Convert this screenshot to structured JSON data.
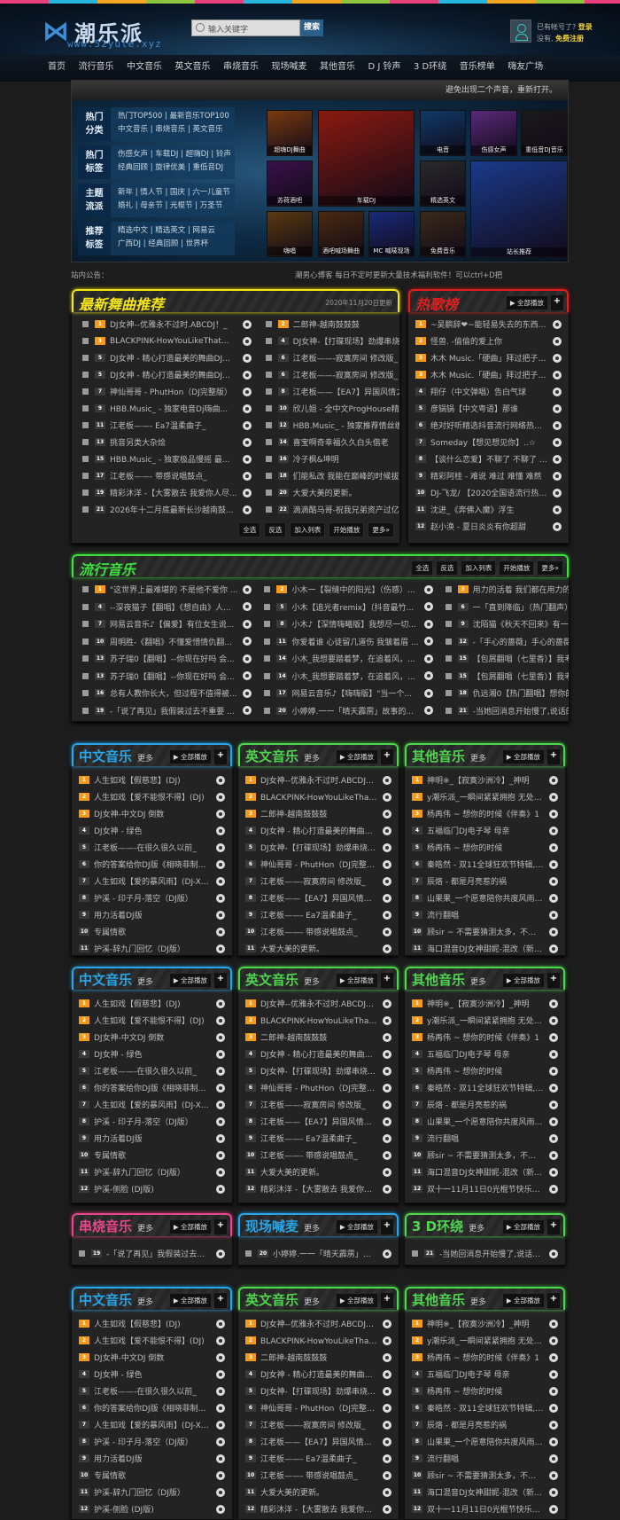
{
  "header": {
    "logo_mark": "⋈",
    "logo_text": "潮乐派",
    "logo_url": "www.52yule.xyz",
    "search_placeholder": "输入关键字",
    "search_button": "搜索",
    "account_prompt": "已有帐号了?",
    "login": "登录",
    "no_account": "没有,",
    "register": "免费注册"
  },
  "nav": [
    "首页",
    "流行音乐",
    "中文音乐",
    "英文音乐",
    "串烧音乐",
    "现场喊麦",
    "其他音乐",
    "D J 铃声",
    "3 D环绕",
    "音乐榜单",
    "嗨友广场"
  ],
  "banner": {
    "bar_text": "避免出现二个声音，重新打开。",
    "categories": [
      {
        "title": "热门分类",
        "line1": "热门TOP500 | 最新音乐TOP100",
        "line2": "中文音乐 | 串烧音乐 | 英文音乐"
      },
      {
        "title": "热门标签",
        "line1": "伤感女声 | 车载DJ | 超嗨DJ | 铃声",
        "line2": "经典回顾 | 旋律优美 | 重低音DJ"
      },
      {
        "title": "主题流派",
        "line1": "新年 | 情人节 | 国庆 | 六一儿童节",
        "line2": "婚礼 | 母亲节 | 光棍节 | 万圣节"
      },
      {
        "title": "推荐标签",
        "line1": "精选中文 | 精选英文 | 网易云",
        "line2": "广西DJ | 经典回顾 | 世界杯"
      }
    ],
    "tiles": [
      "超嗨DJ舞曲",
      "车载DJ",
      "电音",
      "伤感女声",
      "重低音DJ音乐",
      "苏荷酒吧",
      "精选英文",
      "站长推荐",
      "嗨唱",
      "酒吧喊场舞曲",
      "MC 喊唛现场",
      "免费音乐"
    ]
  },
  "notice": {
    "label": "站内公告：",
    "text": "潮男心博客 每日不定时更新大量技术福利软件！可以ctrl+D把"
  },
  "latest": {
    "title": "最新舞曲推荐",
    "date": "2020年11月20日更新",
    "color": "#f5e51b",
    "songs": [
      {
        "n": "1",
        "t": "DJ女神--优雅永不过时.ABCDJ！_"
      },
      {
        "n": "2",
        "t": "二郎神-越南鼓鼓鼓"
      },
      {
        "n": "3",
        "t": "BLACKPINK-HowYouLikeThat..."
      },
      {
        "n": "4",
        "t": "DJ女神-【打碟现场】劲爆串烧蹦..."
      },
      {
        "n": "5",
        "t": "DJ女神 - 精心打造最美的舞曲DJ..."
      },
      {
        "n": "6",
        "t": "江老板——-寂寞房间 修改版_"
      },
      {
        "n": "5",
        "t": "DJ女神 - 精心打造最美的舞曲DJ..."
      },
      {
        "n": "6",
        "t": "江老板——-寂寞房间 修改版_"
      },
      {
        "n": "7",
        "t": "神仙哥哥 - PhutHon（DJ完整版）"
      },
      {
        "n": "8",
        "t": "江老板——【EA7】异国风情之情..."
      },
      {
        "n": "9",
        "t": "HBB.Music_ - 独家电音Dj嗨曲..."
      },
      {
        "n": "10",
        "t": "欣儿姐 - 全中文ProgHouse精选..."
      },
      {
        "n": "11",
        "t": "江老板——- Ea7温柔曲子_"
      },
      {
        "n": "12",
        "t": "HBB.Music_ - 独家推荐情丝缠绕..."
      },
      {
        "n": "13",
        "t": "挑音另类大杂烩"
      },
      {
        "n": "14",
        "t": "喜宝啊奇幸福久久白头偕老"
      },
      {
        "n": "15",
        "t": "HBB.Music_ - 独家极品慢摇 最..."
      },
      {
        "n": "16",
        "t": "冷子枫&坤明"
      },
      {
        "n": "17",
        "t": "江老板——- 带感说唱鼓点_"
      },
      {
        "n": "18",
        "t": "们能私改 我能在巅峰的时候拔鸦..."
      },
      {
        "n": "19",
        "t": "精彩沐洋 -【大雾散去 我爱你人尽..."
      },
      {
        "n": "20",
        "t": "大爱大美的更新。"
      },
      {
        "n": "21",
        "t": "2026年十二月底最新长沙越南鼓..."
      },
      {
        "n": "22",
        "t": "滴滴酷马哥-祝我兄弟资产过亿绝..."
      }
    ],
    "buttons": [
      "全选",
      "反选",
      "加入列表",
      "开始播放",
      "更多»"
    ]
  },
  "hot": {
    "title": "热歌榜",
    "color": "#e02020",
    "play_all": "全部播放",
    "songs": [
      {
        "n": "1",
        "t": "~吴鹏辞❤~能轻易失去的东西确实该..."
      },
      {
        "n": "2",
        "t": "怪兽. -偷偷的爱上你"
      },
      {
        "n": "3",
        "t": "木木 Music.「硬曲」拜过把子发过誓..."
      },
      {
        "n": "3",
        "t": "木木 Music.「硬曲」拜过把子发过誓..."
      },
      {
        "n": "4",
        "t": "翔仔（中文弹唱）告白气球"
      },
      {
        "n": "5",
        "t": "彦锅锅【中文粤语】那谁"
      },
      {
        "n": "6",
        "t": "绝对好听精选抖音流行网络热播无限歌..."
      },
      {
        "n": "7",
        "t": "Someday【想见想见你】..☆"
      },
      {
        "n": "8",
        "t": "【谈什么恋爱】不聊了 不聊了 热门了 ..."
      },
      {
        "n": "9",
        "t": "精彩阿桂 - 难说 难过 难懂 难熬"
      },
      {
        "n": "10",
        "t": "DJ-飞龙/ 【2020全国语流行热播歌曲..."
      },
      {
        "n": "11",
        "t": "沈进_《奔佛入魔》浮生"
      },
      {
        "n": "12",
        "t": "赵小涣 - 夏日炎炎有你超甜"
      }
    ]
  },
  "popular": {
    "title": "流行音乐",
    "color": "#3de03d",
    "buttons": [
      "全选",
      "反选",
      "加入列表",
      "开始播放",
      "更多»"
    ],
    "songs": [
      {
        "n": "1",
        "t": "\"这世界上最难堪的 不是他不爱你 ..."
      },
      {
        "n": "2",
        "t": "小木一【裂缝中的阳光】（伤感）..."
      },
      {
        "n": "3",
        "t": "用力的活着 我们都在用力的活着 ..."
      },
      {
        "n": "4",
        "t": "--深夜猫子【翻唱】《想自由》人..."
      },
      {
        "n": "5",
        "t": "小木【追光者remix】（抖音最竹..."
      },
      {
        "n": "6",
        "t": "一「直到降临」（热门翻声）直到..."
      },
      {
        "n": "7",
        "t": "网易云音乐♪【偏爱】有位女生说..."
      },
      {
        "n": "8",
        "t": "小木♪【深情嗨曦版】我想尽一切..."
      },
      {
        "n": "9",
        "t": "沈陌猫《秋天不回来》有一把伞我..."
      },
      {
        "n": "10",
        "t": "周明胜-《翻唱》不懂爱惜情仇翻..."
      },
      {
        "n": "11",
        "t": "你爱着谁 心徒留几道伤 我皱着眉 ..."
      },
      {
        "n": "12",
        "t": "-「手心的蔷薇」手心的蔷薇 刺伤..."
      },
      {
        "n": "13",
        "t": "苏子瑞0【翻唱】--你现在好吗 会..."
      },
      {
        "n": "14",
        "t": "小木_我想要踏着梦，在追着风，..."
      },
      {
        "n": "15",
        "t": "【包屑翻唱（七里香）】我考虑的..."
      },
      {
        "n": "13",
        "t": "苏子瑞0【翻唱】--你现在好吗 会..."
      },
      {
        "n": "14",
        "t": "小木_我想要踏着梦，在追着风，..."
      },
      {
        "n": "15",
        "t": "【包屑翻唱（七里香）】我考虑的..."
      },
      {
        "n": "16",
        "t": "总有人教你长大，但过程不值得被..."
      },
      {
        "n": "17",
        "t": "网易云音乐♪【嗨嗨版】\"当一个..."
      },
      {
        "n": "18",
        "t": "仇远湘0【热门翻唱】想你的夜,我..."
      },
      {
        "n": "19",
        "t": "-「说了再见」我假装过去不重要 ..."
      },
      {
        "n": "20",
        "t": "小婷婷.一一「晴天霹雳」故事的..."
      },
      {
        "n": "21",
        "t": "-当她回消息开始慢了,说话的语气..."
      }
    ]
  },
  "columns": [
    {
      "title": "中文音乐",
      "more": "更多",
      "play_all": "全部播放",
      "color": "#2aa6e8",
      "songs": [
        "人生如戏【假慈悲】(DJ)",
        "人生如戏【爱不能恨不得】(DJ)",
        "DJ女神-中文DJ 倒数",
        "DJ女神 - 绿色",
        "江老板——-在很久很久以前_",
        "你的答案给你DJ版《相晓菲制作》",
        "人生如戏【爱的暴风雨】(DJ-XYremix)",
        "护溪 - 印子月-落空（DJ版）",
        "用力活着DJ版",
        "专属情歌",
        "护溪-辞九门回忆（DJ版）",
        "护溪-侧脸 (DJ版)"
      ]
    },
    {
      "title": "英文音乐",
      "more": "更多",
      "play_all": "全部播放",
      "color": "#4fd64f",
      "songs": [
        "DJ女神--优雅永不过时.ABCDJ！_",
        "BLACKPINK-HowYouLikeThat你喜...",
        "二郎神-越南鼓鼓鼓",
        "DJ女神 - 精心打造最美的舞曲DJ旋律...",
        "DJ女神-【打碟现场】劲爆串烧蹦迪上...",
        "神仙哥哥 - PhutHon（DJ完整版）",
        "江老板——-寂寞房间 修改版_",
        "江老板——【EA7】异国风情之情上天_",
        "江老板——- Ea7温柔曲子_",
        "江老板——- 带感说唱鼓点_",
        "大爱大美的更新。",
        "精彩沐洋 -【大雾散去 我爱你人尽皆知..."
      ]
    },
    {
      "title": "其他音乐",
      "more": "更多",
      "play_all": "全部播放",
      "color": "#4fd64f",
      "songs": [
        "神明※_【寂寞沙洲冷】_神明",
        "y潮乐派_一瞬间紧紧拥抱 无处可逃 一...",
        "杨再伟 ~ 想你的时候《伴奏》1",
        "五福临门DJ电子琴 母亲",
        "杨再伟 ~ 想你的时候",
        "秦皓然 - 双11全球狂欢节特辑,她说,谈...",
        "辰烙 - 都是月亮惹的祸",
        "山果果_一个愿意陪你共度风雨的人.",
        "流行翻唱",
        "顾sir ~ 不需要猜测太多，不需要猜摩...",
        "海口混音DJ女神甜妮-混改（新版蹦蹦-...",
        "双十一11月11日0光棍节快乐0东西河..."
      ]
    }
  ],
  "mini": [
    {
      "title": "串烧音乐",
      "more": "更多",
      "play_all": "全部播放",
      "color": "#e8468c",
      "n": "19",
      "song": "-「说了再见」我假装过去不重要 ..."
    },
    {
      "title": "现场喊麦",
      "more": "更多",
      "play_all": "全部播放",
      "color": "#2aa6e8",
      "n": "20",
      "song": "小婷婷.一一「晴天霹雳」故事的..."
    },
    {
      "title": "3 D环绕",
      "more": "更多",
      "play_all": "全部播放",
      "color": "#4fd64f",
      "n": "21",
      "song": "-当她回消息开始慢了,说话的语气..."
    }
  ]
}
